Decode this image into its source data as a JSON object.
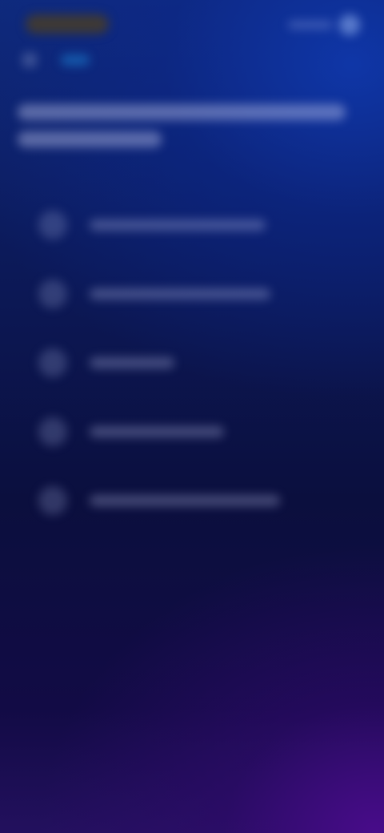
{
  "header": {
    "brand": "",
    "avatar_label": ""
  },
  "subnav": {
    "tab_label": ""
  },
  "page": {
    "title": ""
  },
  "options": [
    {
      "label": "",
      "icon": "option-icon"
    },
    {
      "label": "",
      "icon": "option-icon"
    },
    {
      "label": "",
      "icon": "option-icon"
    },
    {
      "label": "",
      "icon": "option-icon"
    },
    {
      "label": "",
      "icon": "option-icon"
    }
  ],
  "colors": {
    "top_gradient": "#0f2a7a",
    "mid_background": "#0b0f3e",
    "bottom_glow": "#4a0c8c"
  }
}
